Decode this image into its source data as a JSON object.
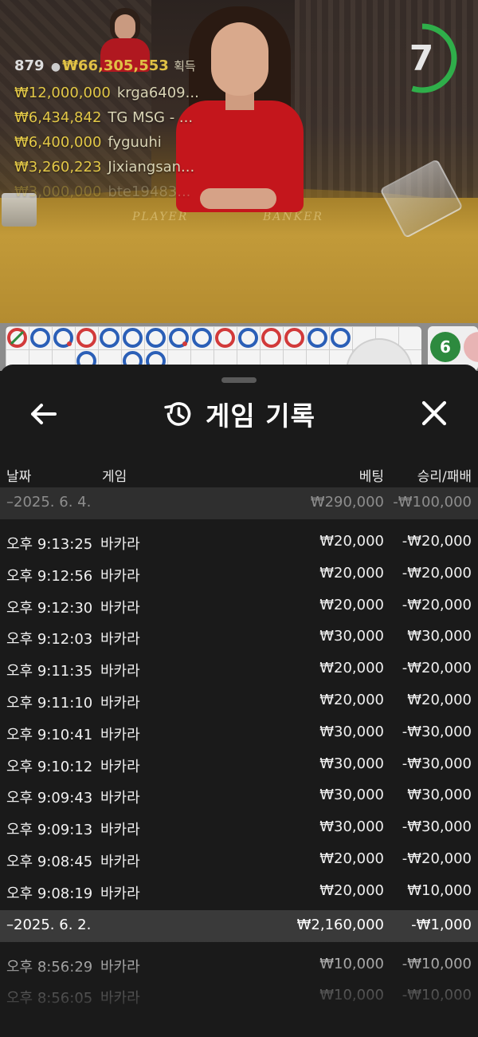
{
  "stream": {
    "felt_player": "PLAYER",
    "felt_banker": "BANKER",
    "countdown": "7",
    "countdown_fraction": 0.55,
    "lobby": {
      "count": "879",
      "total": "₩66,305,553",
      "rank_label": "획득"
    },
    "winners": [
      {
        "amount": "₩12,000,000",
        "name": "krga6409..."
      },
      {
        "amount": "₩6,434,842",
        "name": "TG MSG - ..."
      },
      {
        "amount": "₩6,400,000",
        "name": "fyguuhi"
      },
      {
        "amount": "₩3,260,223",
        "name": "Jixiangsan..."
      },
      {
        "amount": "₩3,000,000",
        "name": "bte19483..."
      }
    ],
    "road_badge": "6",
    "road_beads": [
      "cancel",
      "blue",
      "blue",
      "red",
      "blue",
      "blue",
      "blue",
      "blue",
      "blue",
      "red",
      "blue",
      "red",
      "red",
      "blue",
      "blue"
    ],
    "road_beads_row2": [
      "",
      "",
      "",
      "blue",
      "",
      "blue",
      "blue",
      "",
      "",
      "",
      "",
      "",
      "",
      "",
      ""
    ],
    "colors": {
      "banker": "#d23a3a",
      "player": "#2b5fb7",
      "tie": "#2d8a3e",
      "accent": "#e0c145",
      "timer": "#2fae4a"
    }
  },
  "history": {
    "title": "게임 기록",
    "columns": {
      "date": "날짜",
      "game": "게임",
      "bet": "베팅",
      "result": "승리/패배"
    },
    "day1": {
      "date": "–2025. 6. 4.",
      "bet_total": "₩290,000",
      "result_total": "-₩100,000",
      "rows": [
        {
          "time": "오후 9:13:25",
          "game": "바카라",
          "bet": "₩20,000",
          "result": "-₩20,000"
        },
        {
          "time": "오후 9:12:56",
          "game": "바카라",
          "bet": "₩20,000",
          "result": "-₩20,000"
        },
        {
          "time": "오후 9:12:30",
          "game": "바카라",
          "bet": "₩20,000",
          "result": "-₩20,000"
        },
        {
          "time": "오후 9:12:03",
          "game": "바카라",
          "bet": "₩30,000",
          "result": "₩30,000"
        },
        {
          "time": "오후 9:11:35",
          "game": "바카라",
          "bet": "₩20,000",
          "result": "-₩20,000"
        },
        {
          "time": "오후 9:11:10",
          "game": "바카라",
          "bet": "₩20,000",
          "result": "₩20,000"
        },
        {
          "time": "오후 9:10:41",
          "game": "바카라",
          "bet": "₩30,000",
          "result": "-₩30,000"
        },
        {
          "time": "오후 9:10:12",
          "game": "바카라",
          "bet": "₩30,000",
          "result": "-₩30,000"
        },
        {
          "time": "오후 9:09:43",
          "game": "바카라",
          "bet": "₩30,000",
          "result": "₩30,000"
        },
        {
          "time": "오후 9:09:13",
          "game": "바카라",
          "bet": "₩30,000",
          "result": "-₩30,000"
        },
        {
          "time": "오후 9:08:45",
          "game": "바카라",
          "bet": "₩20,000",
          "result": "-₩20,000"
        },
        {
          "time": "오후 9:08:19",
          "game": "바카라",
          "bet": "₩20,000",
          "result": "₩10,000"
        }
      ]
    },
    "day2": {
      "date": "–2025. 6. 2.",
      "bet_total": "₩2,160,000",
      "result_total": "-₩1,000",
      "rows": [
        {
          "time": "오후 8:56:29",
          "game": "바카라",
          "bet": "₩10,000",
          "result": "-₩10,000"
        },
        {
          "time": "오후 8:56:05",
          "game": "바카라",
          "bet": "₩10,000",
          "result": "-₩10,000"
        }
      ]
    }
  }
}
